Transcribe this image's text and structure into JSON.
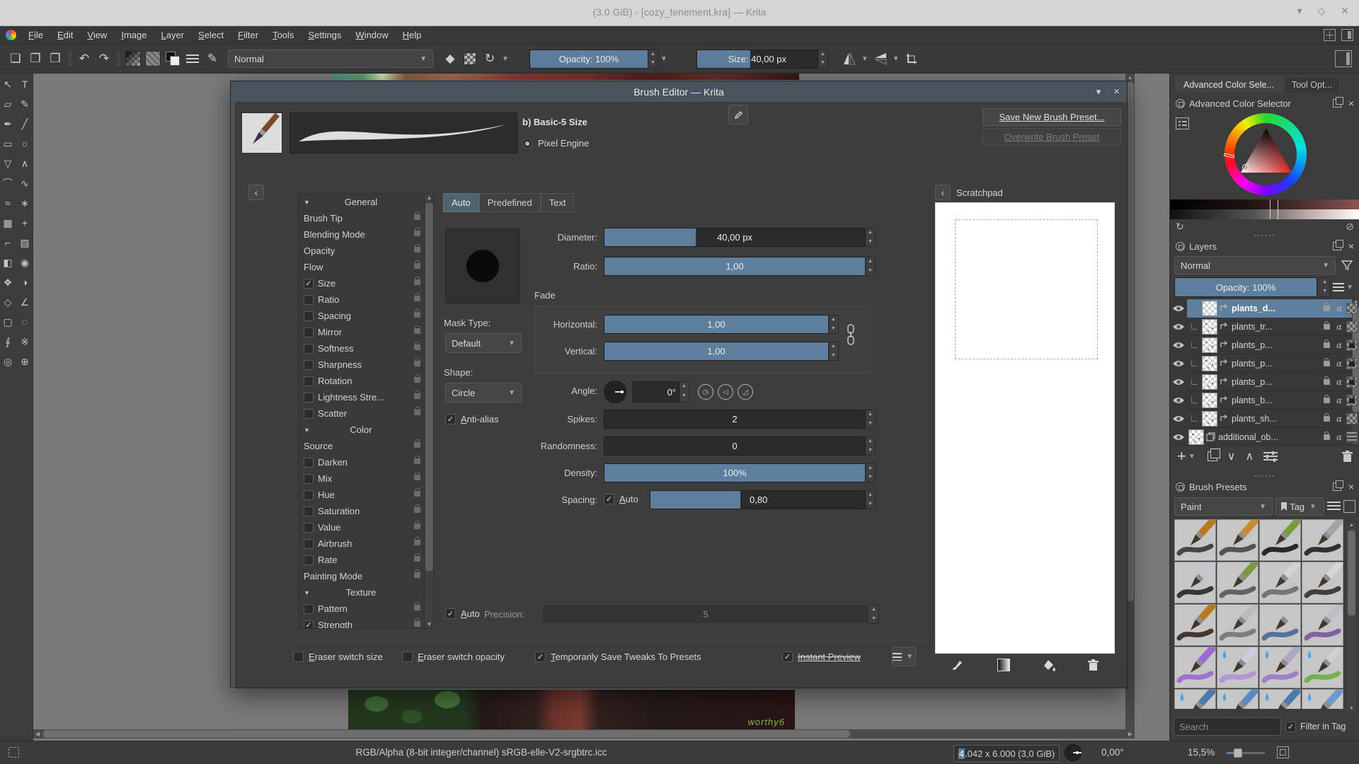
{
  "colors": {
    "accent": "#5d7e9c",
    "dialog_titlebar": "#47545e",
    "window_titlebar": "#d5d5d5",
    "canvas_surround": "#7a7a7a"
  },
  "window": {
    "title": "(3,0 GiB) - [cozy_tenement.kra] — Krita"
  },
  "menu": {
    "items": [
      "File",
      "Edit",
      "View",
      "Image",
      "Layer",
      "Select",
      "Filter",
      "Tools",
      "Settings",
      "Window",
      "Help"
    ]
  },
  "toolbar": {
    "left_icons": [
      {
        "name": "new-file-icon",
        "kind": "glyph",
        "glyph": "❏"
      },
      {
        "name": "open-file-icon",
        "kind": "glyph",
        "glyph": "❐"
      },
      {
        "name": "save-file-icon",
        "kind": "glyph",
        "glyph": "❒"
      },
      {
        "name": "separator",
        "kind": "sep"
      },
      {
        "name": "undo-icon",
        "kind": "glyph",
        "glyph": "↶"
      },
      {
        "name": "redo-icon",
        "kind": "glyph",
        "glyph": "↷"
      },
      {
        "name": "separator",
        "kind": "sep"
      },
      {
        "name": "gradient-chooser-icon",
        "kind": "grad"
      },
      {
        "name": "pattern-chooser-icon",
        "kind": "pattern"
      },
      {
        "name": "fg-bg-colors-icon",
        "kind": "fgbg"
      },
      {
        "name": "brush-options-icon",
        "kind": "bars"
      },
      {
        "name": "brush-editor-icon",
        "kind": "glyph",
        "glyph": "✎"
      }
    ],
    "blending_mode": "Normal",
    "mid_icons": [
      {
        "name": "eraser-mode-icon",
        "kind": "glyph",
        "glyph": "◆"
      },
      {
        "name": "preserve-alpha-icon",
        "kind": "checker"
      },
      {
        "name": "reload-preset-icon",
        "kind": "glyph",
        "glyph": "↻"
      },
      {
        "name": "reload-caret-icon",
        "kind": "caret"
      }
    ],
    "opacity": "Opacity: 100%",
    "size": "Size: 40,00 px",
    "right_icons": [
      {
        "name": "mirror-horizontal-icon",
        "kind": "mirror-h"
      },
      {
        "name": "mirror-caret-icon",
        "kind": "caret"
      },
      {
        "name": "mirror-vertical-icon",
        "kind": "mirror-v"
      },
      {
        "name": "mirror-caret-icon",
        "kind": "caret"
      },
      {
        "name": "trim-canvas-icon",
        "kind": "trim"
      }
    ],
    "workspace_chooser_icon": "choose-workspace-icon"
  },
  "toolbox": {
    "tools": [
      {
        "name": "select-shapes-tool",
        "glyph": "↖"
      },
      {
        "name": "text-tool",
        "glyph": "T"
      },
      {
        "name": "edit-shapes-tool",
        "glyph": "▱"
      },
      {
        "name": "calligraphy-tool",
        "glyph": "✎"
      },
      {
        "name": "freehand-brush-tool",
        "glyph": "✒"
      },
      {
        "name": "line-tool",
        "glyph": "╱"
      },
      {
        "name": "rectangle-tool",
        "glyph": "▭"
      },
      {
        "name": "ellipse-tool",
        "glyph": "○"
      },
      {
        "name": "polygon-tool",
        "glyph": "▽"
      },
      {
        "name": "polyline-tool",
        "glyph": "∧"
      },
      {
        "name": "bezier-curve-tool",
        "glyph": "⌒"
      },
      {
        "name": "freehand-path-tool",
        "glyph": "∿"
      },
      {
        "name": "dynamic-brush-tool",
        "glyph": "≈"
      },
      {
        "name": "multibrush-tool",
        "glyph": "∗"
      },
      {
        "name": "transform-tool",
        "glyph": "▦"
      },
      {
        "name": "move-tool",
        "glyph": "+"
      },
      {
        "name": "crop-tool",
        "glyph": "⌐"
      },
      {
        "name": "gradient-tool",
        "glyph": "▨"
      },
      {
        "name": "fill-tool",
        "glyph": "◧"
      },
      {
        "name": "color-sampler-tool",
        "glyph": "◉"
      },
      {
        "name": "smart-patch-tool",
        "glyph": "❖"
      },
      {
        "name": "colorize-mask-tool",
        "glyph": "◑"
      },
      {
        "name": "assistants-tool",
        "glyph": "◇"
      },
      {
        "name": "measure-tool",
        "glyph": "∠"
      },
      {
        "name": "rectangular-selection-tool",
        "glyph": "▢"
      },
      {
        "name": "elliptical-selection-tool",
        "glyph": "◌"
      },
      {
        "name": "freehand-selection-tool",
        "glyph": "∮"
      },
      {
        "name": "similar-selection-tool",
        "glyph": "※"
      },
      {
        "name": "zoom-tool",
        "glyph": "◎"
      },
      {
        "name": "pan-tool",
        "glyph": "⊕"
      }
    ]
  },
  "dialog": {
    "title": "Brush Editor — Krita",
    "preset_name": "b) Basic-5 Size",
    "engine_label": "Pixel Engine",
    "save_new_label": "Save New Brush Preset...",
    "overwrite_label": "Overwrite Brush Preset",
    "scratchpad_title": "Scratchpad",
    "tabs": [
      {
        "label": "Auto",
        "active": true
      },
      {
        "label": "Predefined",
        "active": false
      },
      {
        "label": "Text",
        "active": false
      }
    ],
    "options": [
      {
        "label": "General",
        "type": "header"
      },
      {
        "label": "Brush Tip",
        "type": "plain"
      },
      {
        "label": "Blending Mode",
        "type": "plain"
      },
      {
        "label": "Opacity",
        "type": "plain"
      },
      {
        "label": "Flow",
        "type": "plain"
      },
      {
        "label": "Size",
        "type": "check",
        "checked": true
      },
      {
        "label": "Ratio",
        "type": "check",
        "checked": false
      },
      {
        "label": "Spacing",
        "type": "check",
        "checked": false
      },
      {
        "label": "Mirror",
        "type": "check",
        "checked": false
      },
      {
        "label": "Softness",
        "type": "check",
        "checked": false
      },
      {
        "label": "Sharpness",
        "type": "check",
        "checked": false
      },
      {
        "label": "Rotation",
        "type": "check",
        "checked": false
      },
      {
        "label": "Lightness Stre...",
        "type": "check",
        "checked": false
      },
      {
        "label": "Scatter",
        "type": "check",
        "checked": false
      },
      {
        "label": "Color",
        "type": "header"
      },
      {
        "label": "Source",
        "type": "plain"
      },
      {
        "label": "Darken",
        "type": "check",
        "checked": false
      },
      {
        "label": "Mix",
        "type": "check",
        "checked": false
      },
      {
        "label": "Hue",
        "type": "check",
        "checked": false
      },
      {
        "label": "Saturation",
        "type": "check",
        "checked": false
      },
      {
        "label": "Value",
        "type": "check",
        "checked": false
      },
      {
        "label": "Airbrush",
        "type": "check",
        "checked": false
      },
      {
        "label": "Rate",
        "type": "check",
        "checked": false
      },
      {
        "label": "Painting Mode",
        "type": "plain"
      },
      {
        "label": "Texture",
        "type": "header"
      },
      {
        "label": "Pattern",
        "type": "check",
        "checked": false
      },
      {
        "label": "Strength",
        "type": "check",
        "checked": true
      }
    ],
    "settings": {
      "diameter_label": "Diameter:",
      "diameter_value": "40,00 px",
      "ratio_label": "Ratio:",
      "ratio_value": "1,00",
      "fade_label": "Fade",
      "horizontal_label": "Horizontal:",
      "horizontal_value": "1,00",
      "vertical_label": "Vertical:",
      "vertical_value": "1,00",
      "mask_type_label": "Mask Type:",
      "mask_type_value": "Default",
      "shape_label": "Shape:",
      "shape_value": "Circle",
      "angle_label": "Angle:",
      "angle_value": "0°",
      "antialias_label": "Anti-alias",
      "spikes_label": "Spikes:",
      "spikes_value": "2",
      "randomness_label": "Randomness:",
      "randomness_value": "0",
      "density_label": "Density:",
      "density_value": "100%",
      "spacing_label": "Spacing:",
      "spacing_auto_label": "Auto",
      "spacing_value": "0,80",
      "auto_label": "Auto",
      "precision_label": "Precision:",
      "precision_value": "5"
    },
    "footer": {
      "eraser_switch_size": "Eraser switch size",
      "eraser_switch_opacity": "Eraser switch opacity",
      "save_tweaks": "Temporarily Save Tweaks To Presets",
      "instant_preview": "Instant Preview"
    }
  },
  "dockers": {
    "tabs": [
      {
        "label": "Advanced Color Sele...",
        "active": true
      },
      {
        "label": "Tool Opt...",
        "active": false
      }
    ],
    "color_selector": {
      "title": "Advanced Color Selector"
    },
    "layers": {
      "title": "Layers",
      "blending_mode": "Normal",
      "opacity": "Opacity: 100%",
      "rows": [
        {
          "name": "plants_d...",
          "selected": true,
          "badge": "checker",
          "speckle": false
        },
        {
          "name": "plants_tr...",
          "selected": false,
          "badge": "checker",
          "speckle": true
        },
        {
          "name": "plants_p...",
          "selected": false,
          "badge": "checker-lock",
          "speckle": true
        },
        {
          "name": "plants_p...",
          "selected": false,
          "badge": "checker-lock",
          "speckle": true
        },
        {
          "name": "plants_p...",
          "selected": false,
          "badge": "checker-lock",
          "speckle": true
        },
        {
          "name": "plants_b...",
          "selected": false,
          "badge": "checker-lock",
          "speckle": true
        },
        {
          "name": "plants_sh...",
          "selected": false,
          "badge": "checker",
          "speckle": true
        },
        {
          "name": "additional_ob...",
          "selected": false,
          "badge": "stripes",
          "speckle": true,
          "group": true
        }
      ]
    },
    "presets": {
      "title": "Brush Presets",
      "tag_value": "Paint",
      "tag_button": "Tag",
      "search_placeholder": "Search",
      "filter_label": "Filter in Tag",
      "tiles": [
        {
          "handle": "#b9791f",
          "stroke": "#3a3a3a",
          "droplet": false
        },
        {
          "handle": "#c98a30",
          "stroke": "#4a4a4a",
          "droplet": false
        },
        {
          "handle": "#7a9a40",
          "stroke": "#1a1a1a",
          "droplet": false
        },
        {
          "handle": "#a3a3a8",
          "stroke": "#242424",
          "droplet": false
        },
        {
          "handle": "#cac5cf",
          "stroke": "#2a2a2a",
          "droplet": false
        },
        {
          "handle": "#7a9a40",
          "stroke": "#5a5a5a",
          "droplet": false
        },
        {
          "handle": "#d5d0da",
          "stroke": "#6e6e6e",
          "droplet": false
        },
        {
          "handle": "#d8d4dc",
          "stroke": "#333333",
          "droplet": false
        },
        {
          "handle": "#b9791f",
          "stroke": "#3a2a20",
          "droplet": false
        },
        {
          "handle": "#bdb8c2",
          "stroke": "#777777",
          "droplet": false
        },
        {
          "handle": "#c8c4cc",
          "stroke": "#4a6a9a",
          "droplet": false
        },
        {
          "handle": "#c0bcc8",
          "stroke": "#7a5a9a",
          "droplet": false
        },
        {
          "handle": "#9a6ad0",
          "stroke": "#9a6ad0",
          "droplet": false
        },
        {
          "handle": "#cfcadf",
          "stroke": "#b090d8",
          "droplet": true
        },
        {
          "handle": "#b0a8c0",
          "stroke": "#9a78c8",
          "droplet": true
        },
        {
          "handle": "#d0d0d0",
          "stroke": "#6ab048",
          "droplet": true
        },
        {
          "handle": "#4a7ab0",
          "stroke": "#88c060",
          "droplet": true
        },
        {
          "handle": "#5a8ac0",
          "stroke": "#90c868",
          "droplet": true
        },
        {
          "handle": "#4a7ab0",
          "stroke": "#84bc5c",
          "droplet": true
        },
        {
          "handle": "#6a9ad0",
          "stroke": "#e8e8e8",
          "droplet": true
        }
      ]
    }
  },
  "statusbar": {
    "color_profile": "RGB/Alpha (8-bit integer/channel)  sRGB-elle-V2-srgbtrc.icc",
    "size_selected": "4",
    "size_rest": ".042 x 6.000 (3,0 GiB)",
    "angle": "0,00°",
    "zoom": "15,5%"
  },
  "canvas": {
    "signature": "worthy6"
  }
}
